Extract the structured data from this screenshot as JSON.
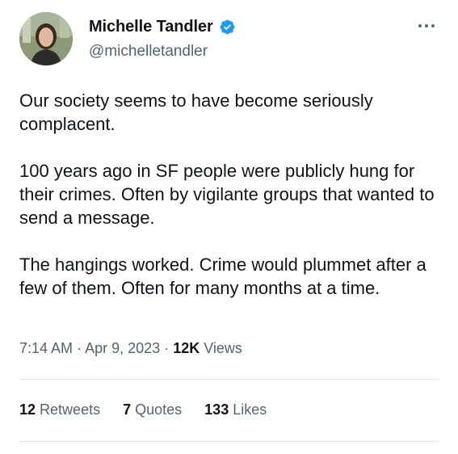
{
  "author": {
    "display_name": "Michelle Tandler",
    "handle": "@michelletandler",
    "verified_icon": "verified-badge-icon",
    "avatar_icon": "profile-photo"
  },
  "menu_icon": "more-options-icon",
  "tweet": {
    "paragraphs": [
      "Our society seems to have become seriously complacent.",
      "100 years ago in SF people were publicly hung for their crimes. Often by vigilante groups that wanted to send a message.",
      "The hangings worked. Crime would plummet after a few of them. Often for many months at a time."
    ]
  },
  "meta": {
    "time": "7:14 AM",
    "separator": "·",
    "date": "Apr 9, 2023",
    "views_count": "12K",
    "views_label": "Views"
  },
  "stats": {
    "retweets_count": "12",
    "retweets_label": "Retweets",
    "quotes_count": "7",
    "quotes_label": "Quotes",
    "likes_count": "133",
    "likes_label": "Likes"
  },
  "colors": {
    "verified": "#1d9bf0",
    "secondary_text": "#536471",
    "primary_text": "#0f1419",
    "divider": "#dfe3e6"
  }
}
